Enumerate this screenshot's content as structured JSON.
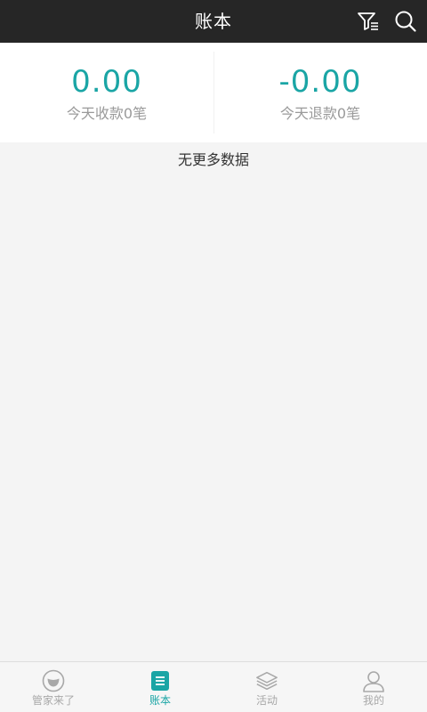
{
  "header": {
    "title": "账本"
  },
  "summary": {
    "income_amount": "0.00",
    "income_label": "今天收款0笔",
    "refund_amount": "-0.00",
    "refund_label": "今天退款0笔"
  },
  "content": {
    "empty_text": "无更多数据"
  },
  "bottom_nav": {
    "items": [
      {
        "label": "管家来了",
        "icon": "smile-icon",
        "active": false
      },
      {
        "label": "账本",
        "icon": "ledger-icon",
        "active": true
      },
      {
        "label": "活动",
        "icon": "layers-icon",
        "active": false
      },
      {
        "label": "我的",
        "icon": "user-icon",
        "active": false
      }
    ]
  },
  "colors": {
    "header_bg": "#262626",
    "accent": "#1aa5a5",
    "inactive": "#a8a8a8"
  }
}
